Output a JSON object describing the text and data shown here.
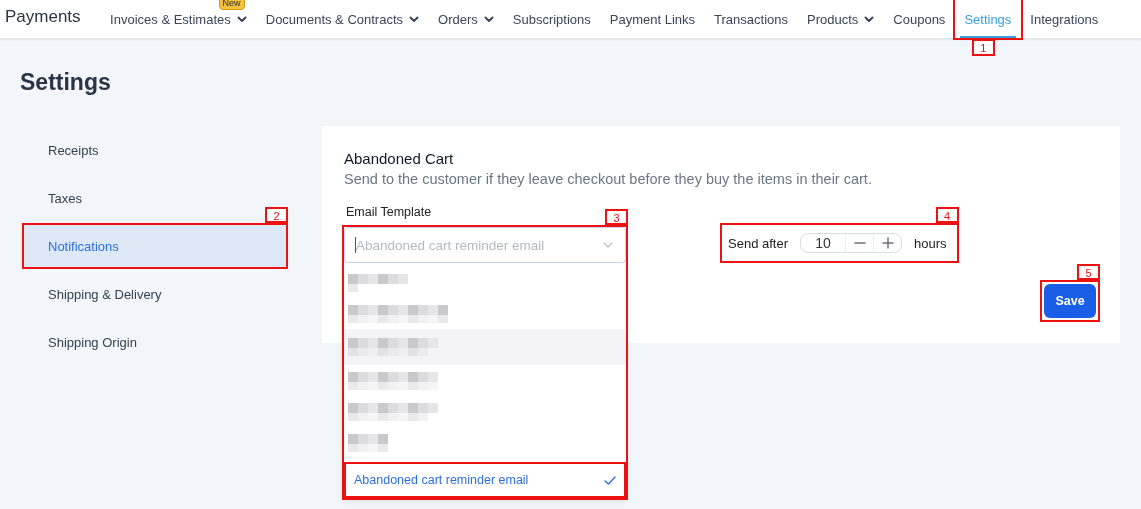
{
  "app": {
    "title": "Payments"
  },
  "nav": [
    {
      "label": "Invoices & Estimates",
      "dropdown": true,
      "badge": "New",
      "selected": false
    },
    {
      "label": "Documents & Contracts",
      "dropdown": true,
      "selected": false
    },
    {
      "label": "Orders",
      "dropdown": true,
      "selected": false
    },
    {
      "label": "Subscriptions",
      "dropdown": false,
      "selected": false
    },
    {
      "label": "Payment Links",
      "dropdown": false,
      "selected": false
    },
    {
      "label": "Transactions",
      "dropdown": false,
      "selected": false
    },
    {
      "label": "Products",
      "dropdown": true,
      "selected": false
    },
    {
      "label": "Coupons",
      "dropdown": false,
      "selected": false
    },
    {
      "label": "Settings",
      "dropdown": false,
      "selected": true,
      "annotation": "1"
    },
    {
      "label": "Integrations",
      "dropdown": false,
      "selected": false
    }
  ],
  "page_title": "Settings",
  "sidebar": [
    {
      "label": "Receipts",
      "selected": false
    },
    {
      "label": "Taxes",
      "selected": false
    },
    {
      "label": "Notifications",
      "selected": true,
      "annotation": "2"
    },
    {
      "label": "Shipping & Delivery",
      "selected": false
    },
    {
      "label": "Shipping Origin",
      "selected": false
    }
  ],
  "section": {
    "title": "Abandoned Cart",
    "description": "Send to the customer if they leave checkout before they buy the items in their cart.",
    "email_template": {
      "label": "Email Template",
      "placeholder": "Abandoned cart reminder email",
      "annotation": "3",
      "options": [
        {
          "kind": "blurred",
          "selected": false,
          "hovered": false
        },
        {
          "kind": "blurred",
          "selected": false,
          "hovered": false
        },
        {
          "kind": "blurred",
          "selected": false,
          "hovered": true
        },
        {
          "kind": "blurred",
          "selected": false,
          "hovered": false
        },
        {
          "kind": "blurred",
          "selected": false,
          "hovered": false
        },
        {
          "kind": "blurred",
          "selected": false,
          "hovered": false
        },
        {
          "kind": "text",
          "label": "Abandoned cart reminder email",
          "selected": true,
          "hovered": false,
          "highlighted": true
        }
      ]
    },
    "send_after": {
      "label": "Send after",
      "value": "10",
      "unit": "hours",
      "annotation": "4"
    },
    "save": {
      "label": "Save",
      "annotation": "5"
    }
  }
}
